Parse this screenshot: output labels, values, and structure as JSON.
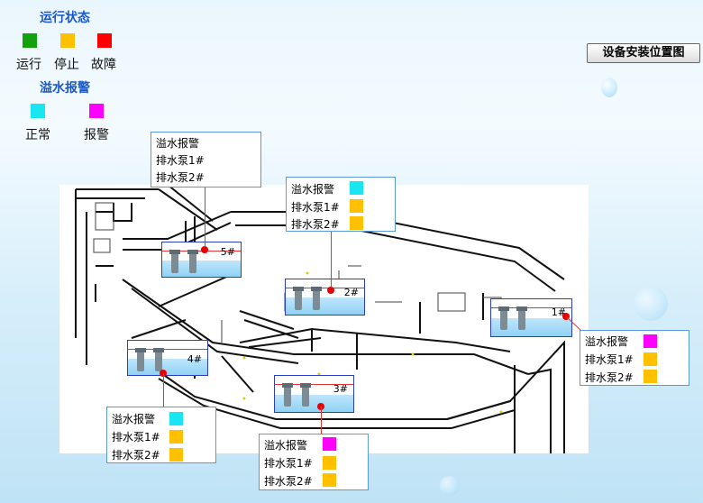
{
  "legend": {
    "status_title": "运行状态",
    "status_items": [
      {
        "label": "运行",
        "color": "#13a10e"
      },
      {
        "label": "停止",
        "color": "#ffc000"
      },
      {
        "label": "故障",
        "color": "#ff0000"
      }
    ],
    "overflow_title": "溢水报警",
    "overflow_items": [
      {
        "label": "正常",
        "color": "#19e6f0"
      },
      {
        "label": "报警",
        "color": "#ff00ff"
      }
    ]
  },
  "toolbar": {
    "location_button": "设备安装位置图"
  },
  "stations": {
    "s5": {
      "label": "5#"
    },
    "s2": {
      "label": "2#"
    },
    "s1": {
      "label": "1#"
    },
    "s4": {
      "label": "4#"
    },
    "s3": {
      "label": "3#"
    }
  },
  "panels": {
    "p5": {
      "rows": [
        "溢水报警",
        "排水泵1#",
        "排水泵2#"
      ],
      "colors": []
    },
    "p2": {
      "rows": [
        "溢水报警",
        "排水泵1#",
        "排水泵2#"
      ],
      "colors": [
        "#19e6f0",
        "#ffc000",
        "#ffc000"
      ]
    },
    "p1": {
      "rows": [
        "溢水报警",
        "排水泵1#",
        "排水泵2#"
      ],
      "colors": [
        "#ff00ff",
        "#ffc000",
        "#ffc000"
      ]
    },
    "p4": {
      "rows": [
        "溢水报警",
        "排水泵1#",
        "排水泵2#"
      ],
      "colors": [
        "#19e6f0",
        "#ffc000",
        "#ffc000"
      ]
    },
    "p3": {
      "rows": [
        "溢水报警",
        "排水泵1#",
        "排水泵2#"
      ],
      "colors": [
        "#ff00ff",
        "#ffc000",
        "#ffc000"
      ]
    }
  }
}
